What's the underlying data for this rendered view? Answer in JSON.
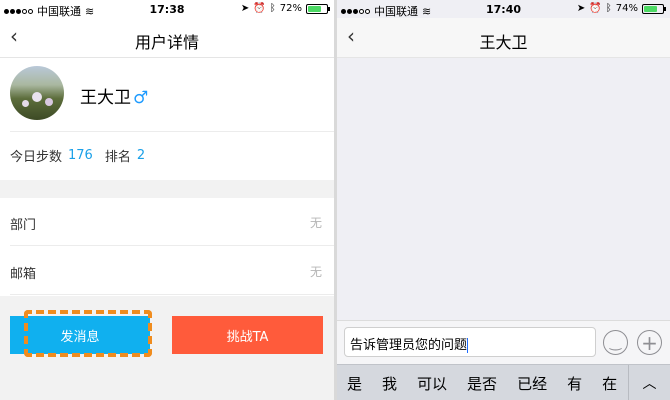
{
  "left": {
    "status": {
      "carrier": "中国联通",
      "time": "17:38",
      "battery": "72%",
      "battery_level": 0.72
    },
    "nav": {
      "back": "‹",
      "title": "用户详情"
    },
    "profile": {
      "name": "王大卫",
      "gender_symbol": "♂"
    },
    "stats": {
      "steps_label": "今日步数",
      "steps_value": "176",
      "rank_label": "排名",
      "rank_value": "2"
    },
    "info": [
      {
        "label": "部门",
        "value": "无"
      },
      {
        "label": "邮箱",
        "value": "无"
      }
    ],
    "buttons": {
      "message": "发消息",
      "challenge": "挑战TA"
    },
    "colors": {
      "message_btn": "#10b0ef",
      "challenge_btn": "#ff5b3b",
      "highlight": "#f08c1e",
      "accent_num": "#1aa0e8"
    }
  },
  "right": {
    "status": {
      "carrier": "中国联通",
      "time": "17:40",
      "battery": "74%",
      "battery_level": 0.74
    },
    "nav": {
      "back": "‹",
      "title": "王大卫"
    },
    "input": {
      "value": "告诉管理员您的问题"
    },
    "icons": {
      "emoji": "smiley-icon",
      "plus": "plus-icon"
    },
    "candidates": [
      "是",
      "我",
      "可以",
      "是否",
      "已经",
      "有",
      "在"
    ],
    "expand": "︿"
  }
}
